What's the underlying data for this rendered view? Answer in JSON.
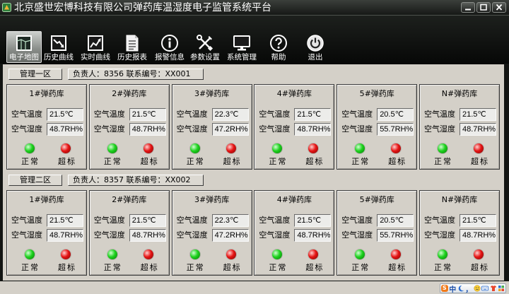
{
  "window": {
    "title": "北京盛世宏博科技有限公司弹药库温湿度电子监管系统平台",
    "app_icon": "app-logo-icon",
    "controls": [
      "minimize-icon",
      "maximize-icon",
      "close-icon"
    ]
  },
  "toolbar": {
    "items": [
      {
        "label": "电子地图",
        "icon": "map-icon",
        "selected": true
      },
      {
        "label": "历史曲线",
        "icon": "history-curve-icon"
      },
      {
        "label": "实时曲线",
        "icon": "realtime-curve-icon"
      },
      {
        "label": "历史报表",
        "icon": "history-report-icon"
      },
      {
        "label": "报警信息",
        "icon": "alarm-info-icon"
      },
      {
        "label": "参数设置",
        "icon": "settings-tools-icon"
      },
      {
        "label": "系统管理",
        "icon": "system-monitor-icon"
      },
      {
        "label": "帮助",
        "icon": "help-icon"
      },
      {
        "label": "退出",
        "icon": "power-exit-icon"
      }
    ]
  },
  "zones": [
    {
      "name": "管理一区",
      "info": "负责人：8356 联系编号：XX001",
      "depots": [
        {
          "title": "1#弹药库",
          "temp_label": "空气温度",
          "temperature": "21.5℃",
          "humidity_label": "空气湿度",
          "humidity": "48.7RH%",
          "normal_label": "正常",
          "over_label": "超标"
        },
        {
          "title": "2#弹药库",
          "temp_label": "空气温度",
          "temperature": "21.5℃",
          "humidity_label": "空气湿度",
          "humidity": "48.7RH%",
          "normal_label": "正常",
          "over_label": "超标"
        },
        {
          "title": "3#弹药库",
          "temp_label": "空气温度",
          "temperature": "22.3℃",
          "humidity_label": "空气湿度",
          "humidity": "47.2RH%",
          "normal_label": "正常",
          "over_label": "超标"
        },
        {
          "title": "4#弹药库",
          "temp_label": "空气温度",
          "temperature": "21.5℃",
          "humidity_label": "空气湿度",
          "humidity": "48.7RH%",
          "normal_label": "正常",
          "over_label": "超标"
        },
        {
          "title": "5#弹药库",
          "temp_label": "空气温度",
          "temperature": "20.5℃",
          "humidity_label": "空气湿度",
          "humidity": "55.7RH%",
          "normal_label": "正常",
          "over_label": "超标"
        },
        {
          "title": "N#弹药库",
          "temp_label": "空气温度",
          "temperature": "21.5℃",
          "humidity_label": "空气湿度",
          "humidity": "48.7RH%",
          "normal_label": "正常",
          "over_label": "超标"
        }
      ]
    },
    {
      "name": "管理二区",
      "info": "负责人：8357 联系编号：XX002",
      "depots": [
        {
          "title": "1#弹药库",
          "temp_label": "空气温度",
          "temperature": "21.5℃",
          "humidity_label": "空气湿度",
          "humidity": "48.7RH%",
          "normal_label": "正常",
          "over_label": "超标"
        },
        {
          "title": "2#弹药库",
          "temp_label": "空气温度",
          "temperature": "21.5℃",
          "humidity_label": "空气湿度",
          "humidity": "48.7RH%",
          "normal_label": "正常",
          "over_label": "超标"
        },
        {
          "title": "3#弹药库",
          "temp_label": "空气温度",
          "temperature": "22.3℃",
          "humidity_label": "空气湿度",
          "humidity": "47.2RH%",
          "normal_label": "正常",
          "over_label": "超标"
        },
        {
          "title": "4#弹药库",
          "temp_label": "空气温度",
          "temperature": "21.5℃",
          "humidity_label": "空气湿度",
          "humidity": "48.7RH%",
          "normal_label": "正常",
          "over_label": "超标"
        },
        {
          "title": "5#弹药库",
          "temp_label": "空气温度",
          "temperature": "20.5℃",
          "humidity_label": "空气湿度",
          "humidity": "55.7RH%",
          "normal_label": "正常",
          "over_label": "超标"
        },
        {
          "title": "N#弹药库",
          "temp_label": "空气温度",
          "temperature": "21.5℃",
          "humidity_label": "空气湿度",
          "humidity": "48.7RH%",
          "normal_label": "正常",
          "over_label": "超标"
        }
      ]
    }
  ],
  "ime_bar": {
    "logo": "S",
    "mode": "中",
    "punctuation": "，",
    "icons": [
      "half-width-moon-icon",
      "emoji-icon",
      "keyboard-icon",
      "skin-shirt-icon",
      "toolbox-grid-icon"
    ]
  },
  "colors": {
    "normal_light": "#1ed21e",
    "over_limit_light": "#e61414",
    "panel_bg": "#d4d0c8",
    "frame_dark": "#121412",
    "title_text": "#ffffff"
  }
}
